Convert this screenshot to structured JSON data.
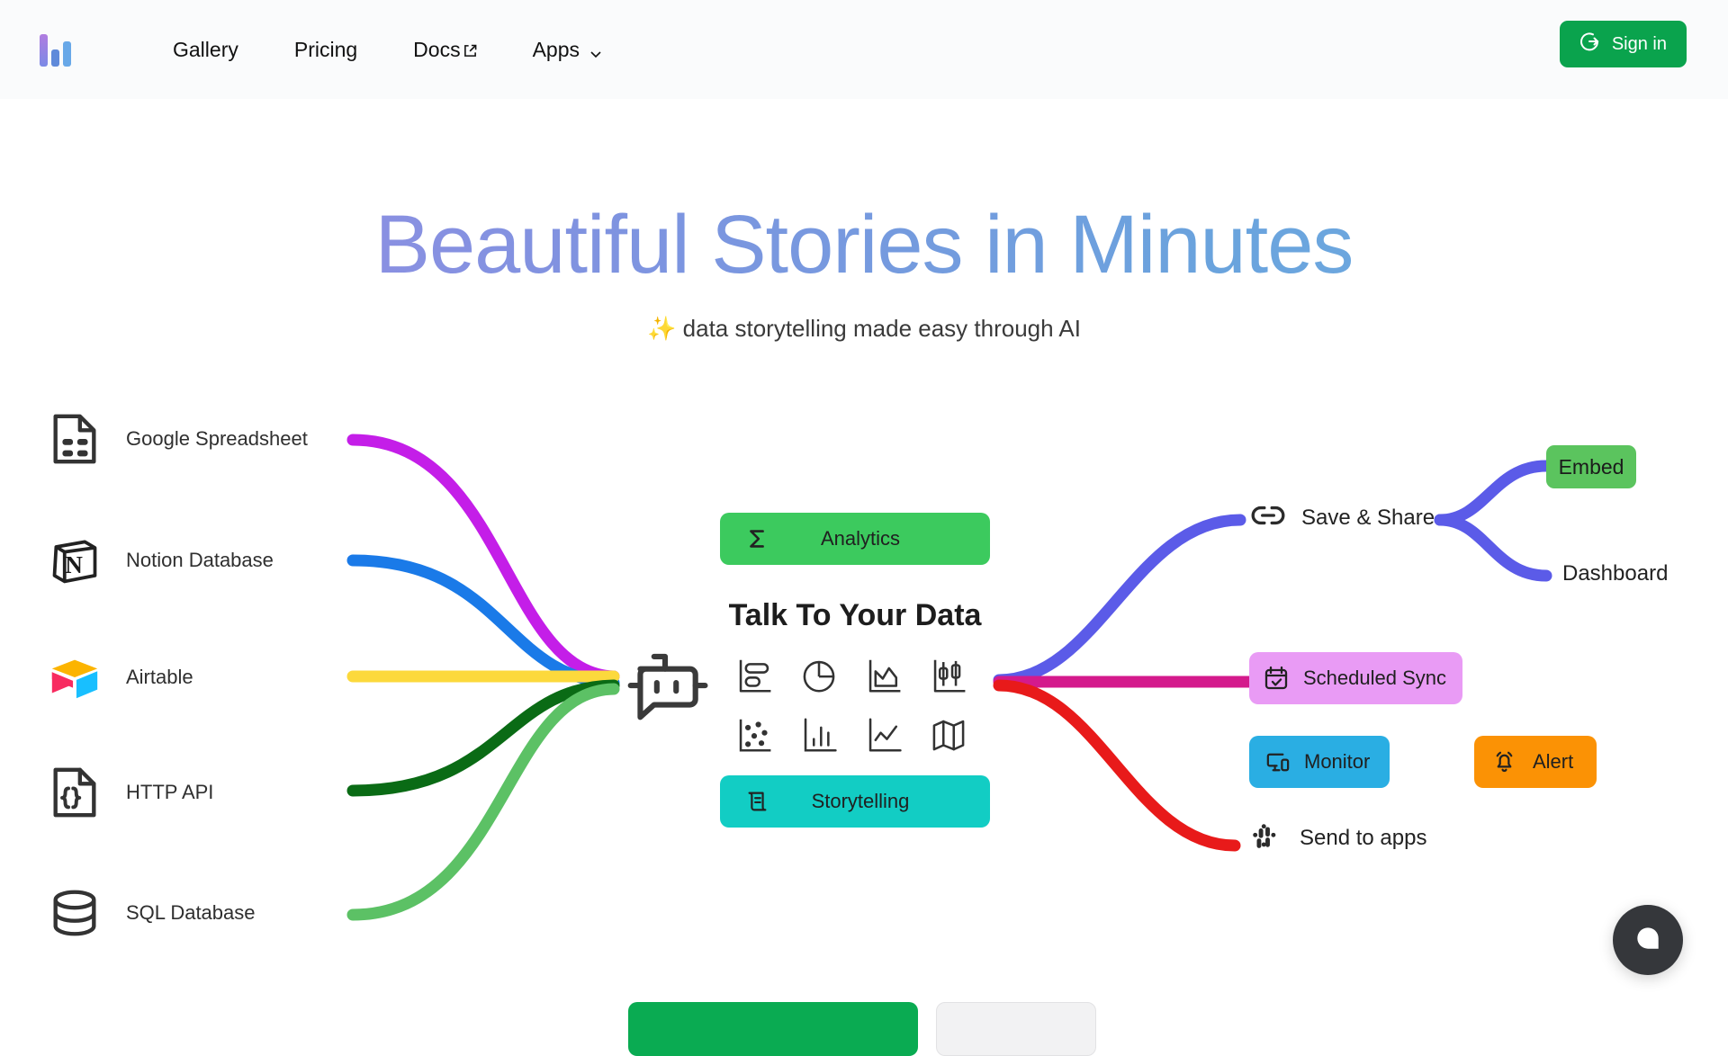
{
  "header": {
    "logo_name": "logo",
    "nav": [
      {
        "label": "Gallery",
        "icon": ""
      },
      {
        "label": "Pricing",
        "icon": ""
      },
      {
        "label": "Docs",
        "icon": "external-link-icon"
      },
      {
        "label": "Apps",
        "icon": "chevron-down-icon"
      }
    ],
    "signin_label": "Sign in",
    "signin_icon": "sign-in-icon",
    "signin_color": "#0aa34d"
  },
  "hero": {
    "title": "Beautiful Stories in Minutes",
    "subtitle": "✨ data storytelling made easy through AI",
    "gradient_from": "#9b8ce4",
    "gradient_to": "#71b0e2"
  },
  "diagram": {
    "sources": [
      {
        "label": "Google Spreadsheet",
        "icon": "spreadsheet-file-icon",
        "connector_color": "#c41ee8"
      },
      {
        "label": "Notion Database",
        "icon": "notion-icon",
        "connector_color": "#1a7ae8"
      },
      {
        "label": "Airtable",
        "icon": "airtable-icon",
        "connector_color": "#fcd93c"
      },
      {
        "label": "HTTP API",
        "icon": "braces-file-icon",
        "connector_color": "#0a6b15"
      },
      {
        "label": "SQL Database",
        "icon": "database-cylinder-icon",
        "connector_color": "#5cc165"
      }
    ],
    "hub": {
      "bot_icon": "chat-bot-icon",
      "title": "Talk To Your Data",
      "analytics": {
        "label": "Analytics",
        "icon": "sigma-icon",
        "color": "#3cca5e"
      },
      "storytelling": {
        "label": "Storytelling",
        "icon": "scroll-icon",
        "color": "#12cdc4"
      },
      "chart_icons": [
        "bar-horizontal-chart-icon",
        "pie-chart-icon",
        "area-chart-icon",
        "candlestick-chart-icon",
        "scatter-chart-icon",
        "column-chart-icon",
        "line-chart-icon",
        "map-chart-icon"
      ]
    },
    "outputs": [
      {
        "label": "Save & Share",
        "icon": "link-icon",
        "connector_color": "#5b5be8",
        "badge": false
      },
      {
        "label": "Scheduled Sync",
        "icon": "calendar-check-icon",
        "connector_color": "#d41a8c",
        "badge": true,
        "color": "#e99bf5"
      },
      {
        "label": "Send to apps",
        "icon": "slack-icon",
        "connector_color": "#e81a1a",
        "badge": false
      }
    ],
    "share_children": [
      {
        "label": "Embed",
        "badge": true,
        "color": "#5bc45e",
        "connector_color": "#5b5be8"
      },
      {
        "label": "Dashboard",
        "badge": false,
        "color": "",
        "connector_color": "#5b5be8"
      }
    ],
    "extras": [
      {
        "label": "Monitor",
        "icon": "monitor-icon",
        "color": "#2aaee3"
      },
      {
        "label": "Alert",
        "icon": "bell-icon",
        "color": "#fb9205"
      }
    ]
  },
  "chat": {
    "icon": "chat-bubble-icon",
    "color": "#35373b"
  }
}
